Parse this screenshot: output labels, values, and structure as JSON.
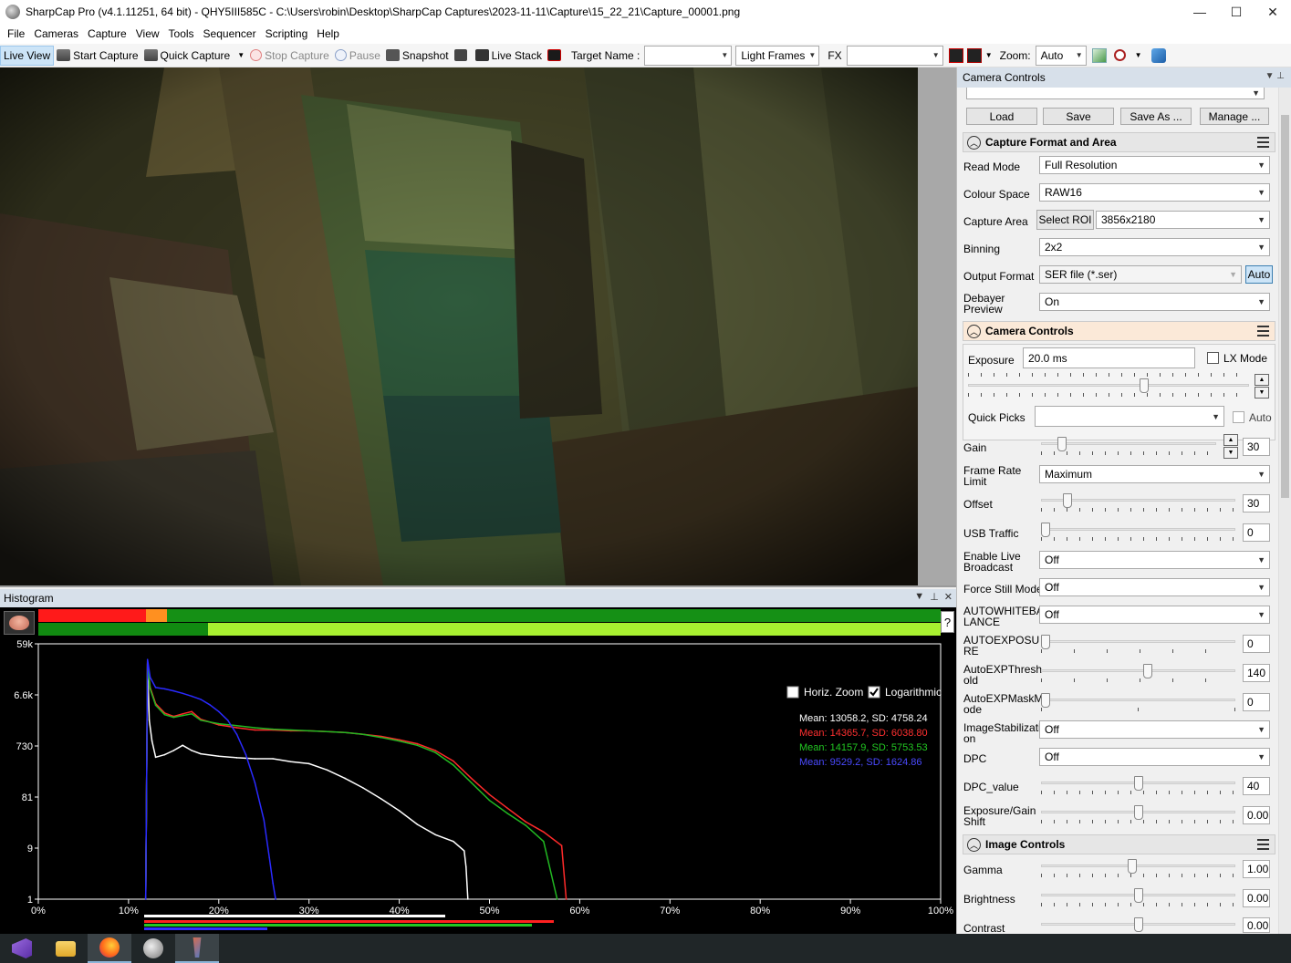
{
  "window": {
    "title": "SharpCap Pro (v4.1.11251, 64 bit) - QHY5III585C - C:\\Users\\robin\\Desktop\\SharpCap Captures\\2023-11-11\\Capture\\15_22_21\\Capture_00001.png",
    "minimize": "—",
    "maximize": "☐",
    "close": "✕"
  },
  "menu": [
    "File",
    "Cameras",
    "Capture",
    "View",
    "Tools",
    "Sequencer",
    "Scripting",
    "Help"
  ],
  "toolbar": {
    "live_view": "Live View",
    "start_capture": "Start Capture",
    "quick_capture": "Quick Capture",
    "stop_capture": "Stop Capture",
    "pause": "Pause",
    "snapshot": "Snapshot",
    "live_stack": "Live Stack",
    "target_name_label": "Target Name :",
    "target_name_value": "",
    "frame_type": "Light Frames",
    "fx_label": "FX",
    "fx_value": "",
    "zoom_label": "Zoom:",
    "zoom_value": "Auto"
  },
  "histogram": {
    "title": "Histogram",
    "help": "?",
    "horiz_zoom_label": "Horiz. Zoom",
    "horiz_zoom_checked": false,
    "logarithmic_label": "Logarithmic",
    "logarithmic_checked": true,
    "stats": [
      {
        "text": "Mean: 13058.2, SD: 4758.24",
        "color": "#ffffff"
      },
      {
        "text": "Mean: 14365.7, SD: 6038.80",
        "color": "#ff3030"
      },
      {
        "text": "Mean: 14157.9, SD: 5753.53",
        "color": "#22c822"
      },
      {
        "text": "Mean: 9529.2, SD: 1624.86",
        "color": "#4a4aff"
      }
    ]
  },
  "chart_data": {
    "type": "line",
    "title": "",
    "xlabel": "",
    "ylabel": "",
    "x_ticks": [
      "0%",
      "10%",
      "20%",
      "30%",
      "40%",
      "50%",
      "60%",
      "70%",
      "80%",
      "90%",
      "100%"
    ],
    "y_ticks": [
      "59k",
      "6.6k",
      "730",
      "81",
      "9",
      "1"
    ],
    "y_scale": "log",
    "xlim": [
      0,
      100
    ],
    "ylim": [
      1,
      59000
    ],
    "series": [
      {
        "name": "",
        "color": "#ffffff",
        "x": [
          11.9,
          12.1,
          12.3,
          12.6,
          13,
          14,
          15,
          16,
          17,
          18,
          20,
          22,
          24,
          26,
          28,
          30,
          32,
          34,
          36,
          38,
          40,
          42,
          44,
          46,
          47.2,
          47.4,
          47.6
        ],
        "y": [
          1,
          25000,
          2200,
          900,
          450,
          500,
          600,
          750,
          600,
          520,
          470,
          440,
          420,
          420,
          370,
          340,
          260,
          180,
          120,
          75,
          45,
          25,
          16,
          12,
          8,
          4,
          1
        ]
      },
      {
        "name": "",
        "color": "#ff2a2a",
        "x": [
          11.9,
          12.1,
          12.4,
          13,
          14,
          15,
          16,
          17,
          18,
          20,
          22,
          24,
          26,
          28,
          30,
          32,
          34,
          36,
          38,
          40,
          42,
          44,
          46,
          48,
          50,
          52,
          54,
          56,
          58,
          58.5
        ],
        "y": [
          1,
          28000,
          9000,
          4500,
          3000,
          2600,
          2900,
          3200,
          2300,
          1800,
          1600,
          1450,
          1450,
          1400,
          1400,
          1350,
          1300,
          1200,
          1100,
          950,
          800,
          600,
          380,
          180,
          90,
          50,
          28,
          18,
          10,
          1
        ]
      },
      {
        "name": "",
        "color": "#22b822",
        "x": [
          11.9,
          12.1,
          12.4,
          13,
          14,
          15,
          16,
          17,
          18,
          20,
          22,
          24,
          26,
          28,
          30,
          32,
          34,
          36,
          38,
          40,
          42,
          44,
          46,
          48,
          50,
          52,
          54,
          56,
          57.5
        ],
        "y": [
          1,
          26000,
          8500,
          4200,
          2800,
          2500,
          2700,
          2900,
          2200,
          1900,
          1750,
          1600,
          1500,
          1450,
          1400,
          1350,
          1300,
          1200,
          1050,
          900,
          750,
          550,
          320,
          150,
          70,
          40,
          24,
          12,
          1
        ]
      },
      {
        "name": "",
        "color": "#2a2aff",
        "x": [
          11.9,
          12.1,
          12.4,
          13,
          14,
          15,
          16,
          17,
          18,
          19,
          20,
          21,
          22,
          23,
          24,
          25,
          25.6,
          26,
          26.3
        ],
        "y": [
          1,
          30000,
          14000,
          9000,
          8500,
          7800,
          7000,
          6200,
          5400,
          4300,
          3200,
          2200,
          1200,
          500,
          150,
          30,
          6,
          2,
          1
        ]
      }
    ]
  },
  "camera_panel": {
    "title": "Camera Controls",
    "profile": "",
    "load": "Load",
    "save": "Save",
    "save_as": "Save As ...",
    "manage": "Manage ...",
    "sections": {
      "capture_format": "Capture Format and Area",
      "camera_controls": "Camera Controls",
      "image_controls": "Image Controls"
    },
    "read_mode": {
      "label": "Read Mode",
      "value": "Full Resolution"
    },
    "colour_space": {
      "label": "Colour Space",
      "value": "RAW16"
    },
    "capture_area": {
      "label": "Capture Area",
      "button": "Select ROI",
      "value": "3856x2180"
    },
    "binning": {
      "label": "Binning",
      "value": "2x2"
    },
    "output_format": {
      "label": "Output Format",
      "value": "SER file (*.ser)",
      "auto": "Auto"
    },
    "debayer": {
      "label1": "Debayer",
      "label2": "Preview",
      "value": "On"
    },
    "exposure": {
      "label": "Exposure",
      "value": "20.0 ms",
      "lx_mode": "LX Mode",
      "slider": 0.63
    },
    "quick_picks": {
      "label": "Quick Picks",
      "value": "",
      "auto": "Auto"
    },
    "gain": {
      "label": "Gain",
      "value": "30",
      "slider": 0.1
    },
    "frame_rate": {
      "label1": "Frame Rate",
      "label2": "Limit",
      "value": "Maximum"
    },
    "offset": {
      "label": "Offset",
      "value": "30",
      "slider": 0.12
    },
    "usb_traffic": {
      "label": "USB Traffic",
      "value": "0",
      "slider": 0.0
    },
    "live_broadcast": {
      "label1": "Enable Live",
      "label2": "Broadcast",
      "value": "Off"
    },
    "force_still": {
      "label": "Force Still Mode",
      "value": "Off"
    },
    "autowb": {
      "label1": "AUTOWHITEBA",
      "label2": "LANCE",
      "value": "Off"
    },
    "autoexposure": {
      "label1": "AUTOEXPOSU",
      "label2": "RE",
      "value": "0",
      "slider": 0.0
    },
    "autoexp_thresh": {
      "label1": "AutoEXPThresh",
      "label2": "old",
      "value": "140",
      "slider": 0.55
    },
    "autoexp_mask": {
      "label1": "AutoEXPMaskM",
      "label2": "ode",
      "value": "0",
      "slider": 0.0
    },
    "image_stab": {
      "label1": "ImageStabilizati",
      "label2": "on",
      "value": "Off"
    },
    "dpc": {
      "label": "DPC",
      "value": "Off"
    },
    "dpc_value": {
      "label": "DPC_value",
      "value": "40",
      "slider": 0.5
    },
    "exp_gain_shift": {
      "label1": "Exposure/Gain",
      "label2": "Shift",
      "value": "0.00",
      "slider": 0.5
    },
    "gamma": {
      "label": "Gamma",
      "value": "1.00",
      "slider": 0.47
    },
    "brightness": {
      "label": "Brightness",
      "value": "0.00",
      "slider": 0.5
    },
    "contrast": {
      "label": "Contrast",
      "value": "0.00",
      "slider": 0.5
    }
  },
  "taskbar": [
    "visual-studio",
    "file-explorer",
    "firefox",
    "sharpcap-scope",
    "sharpcap"
  ]
}
